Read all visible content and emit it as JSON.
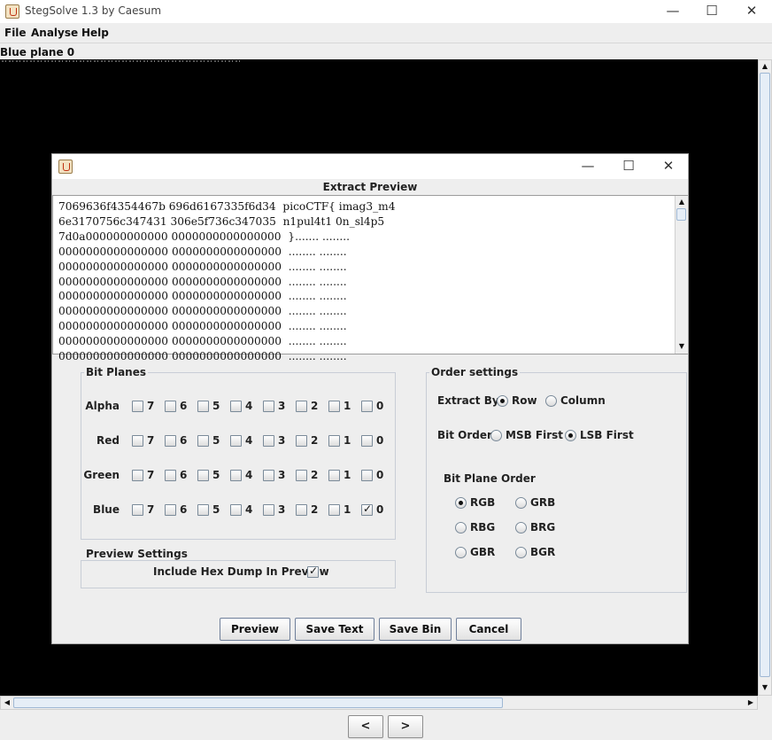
{
  "window": {
    "title": "StegSolve 1.3 by Caesum",
    "minimize": "—",
    "maximize": "☐",
    "close": "✕"
  },
  "menubar": {
    "file": "File",
    "analyse": "Analyse",
    "help": "Help"
  },
  "plane_label": "Blue plane 0",
  "nav": {
    "prev": "<",
    "next": ">"
  },
  "dialog": {
    "minimize": "—",
    "maximize": "☐",
    "close": "✕",
    "preview_heading": "Extract Preview",
    "hex_lines": [
      "7069636f4354467b 696d6167335f6d34  picoCTF{ imag3_m4",
      "6e3170756c347431 306e5f736c347035  n1pul4t1 0n_sl4p5",
      "7d0a000000000000 0000000000000000  }....... ........",
      "0000000000000000 0000000000000000  ........ ........",
      "0000000000000000 0000000000000000  ........ ........",
      "0000000000000000 0000000000000000  ........ ........",
      "0000000000000000 0000000000000000  ........ ........",
      "0000000000000000 0000000000000000  ........ ........",
      "0000000000000000 0000000000000000  ........ ........",
      "0000000000000000 0000000000000000  ........ ........",
      "0000000000000000 0000000000000000  ........ ........"
    ],
    "bit_planes": {
      "label": "Bit Planes",
      "bits": [
        "7",
        "6",
        "5",
        "4",
        "3",
        "2",
        "1",
        "0"
      ],
      "channels": [
        {
          "name": "Alpha",
          "checked": []
        },
        {
          "name": "Red",
          "checked": []
        },
        {
          "name": "Green",
          "checked": []
        },
        {
          "name": "Blue",
          "checked": [
            "0"
          ]
        }
      ]
    },
    "preview_settings": {
      "label": "Preview Settings",
      "hex_dump_label": "Include Hex Dump In Preview",
      "hex_dump_checked": true
    },
    "order_settings": {
      "label": "Order settings",
      "extract_by": {
        "label": "Extract By",
        "options": [
          "Row",
          "Column"
        ],
        "selected": "Row"
      },
      "bit_order": {
        "label": "Bit Order",
        "options": [
          "MSB First",
          "LSB First"
        ],
        "selected": "LSB First"
      },
      "bit_plane_order": {
        "label": "Bit Plane Order",
        "options": [
          "RGB",
          "GRB",
          "RBG",
          "BRG",
          "GBR",
          "BGR"
        ],
        "selected": "RGB"
      }
    },
    "buttons": {
      "preview": "Preview",
      "save_text": "Save Text",
      "save_bin": "Save Bin",
      "cancel": "Cancel"
    }
  },
  "colors": {
    "image_bg": "#000000",
    "window_bg": "#eeeeee",
    "accent": "#9fb8d4"
  }
}
